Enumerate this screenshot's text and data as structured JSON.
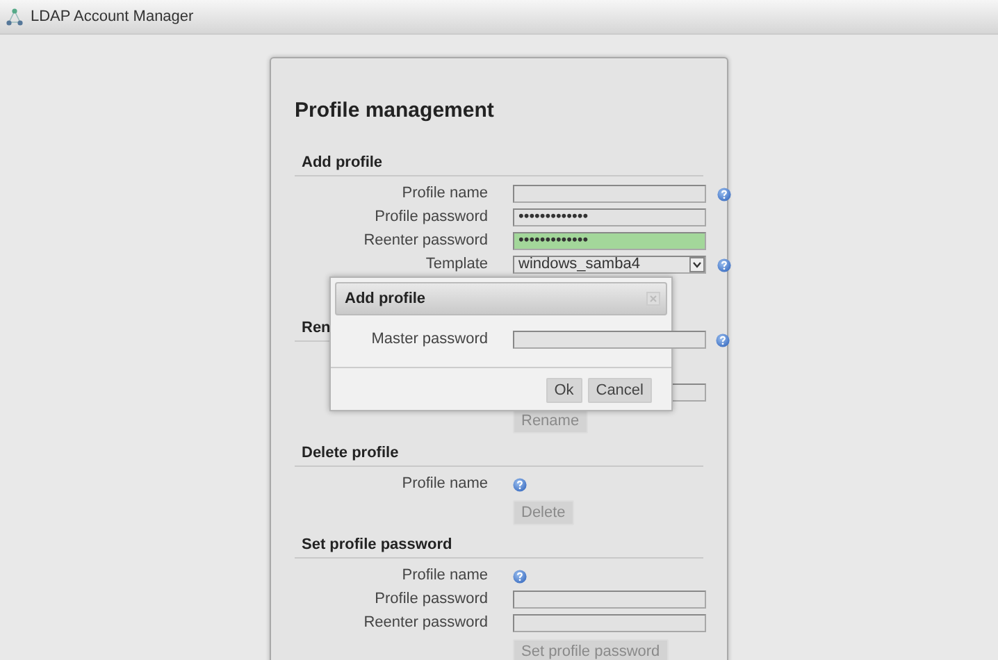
{
  "header": {
    "title": "LDAP Account Manager"
  },
  "panel": {
    "title": "Profile management",
    "sections": [
      {
        "heading": "Add profile",
        "rows": [
          {
            "label": "Profile name",
            "field": {
              "kind": "text",
              "valid": false
            },
            "help": true
          },
          {
            "label": "Profile password",
            "field": {
              "kind": "text",
              "value": "•••••••••••••",
              "valid": false
            },
            "help": false
          },
          {
            "label": "Reenter password",
            "field": {
              "kind": "text",
              "value": "•••••••••••••",
              "valid": true
            },
            "help": false
          },
          {
            "label": "Template",
            "field": {
              "kind": "select",
              "value": "windows_samba4"
            },
            "help": true
          }
        ]
      },
      {
        "heading": "Ren",
        "rows": [
          {
            "field": {
              "kind": "text",
              "valid": false
            },
            "help": false
          }
        ],
        "button": {
          "label": "Rename",
          "disabled": true
        }
      },
      {
        "heading": "Delete profile",
        "rows": [
          {
            "label": "Profile name",
            "field": {
              "kind": "none"
            },
            "help": true
          }
        ],
        "button": {
          "label": "Delete",
          "disabled": true
        }
      },
      {
        "heading": "Set profile password",
        "rows": [
          {
            "label": "Profile name",
            "field": {
              "kind": "none"
            },
            "help": true
          },
          {
            "label": "Profile password",
            "field": {
              "kind": "text",
              "valid": false
            },
            "help": false
          },
          {
            "label": "Reenter password",
            "field": {
              "kind": "text",
              "valid": false
            },
            "help": false
          }
        ],
        "button": {
          "label": "Set profile password",
          "disabled": true
        }
      }
    ]
  },
  "dialog": {
    "title": "Add profile",
    "label": "Master password",
    "help": true,
    "buttons": [
      {
        "label": "Ok",
        "disabled": false
      },
      {
        "label": "Cancel",
        "disabled": false
      }
    ]
  }
}
